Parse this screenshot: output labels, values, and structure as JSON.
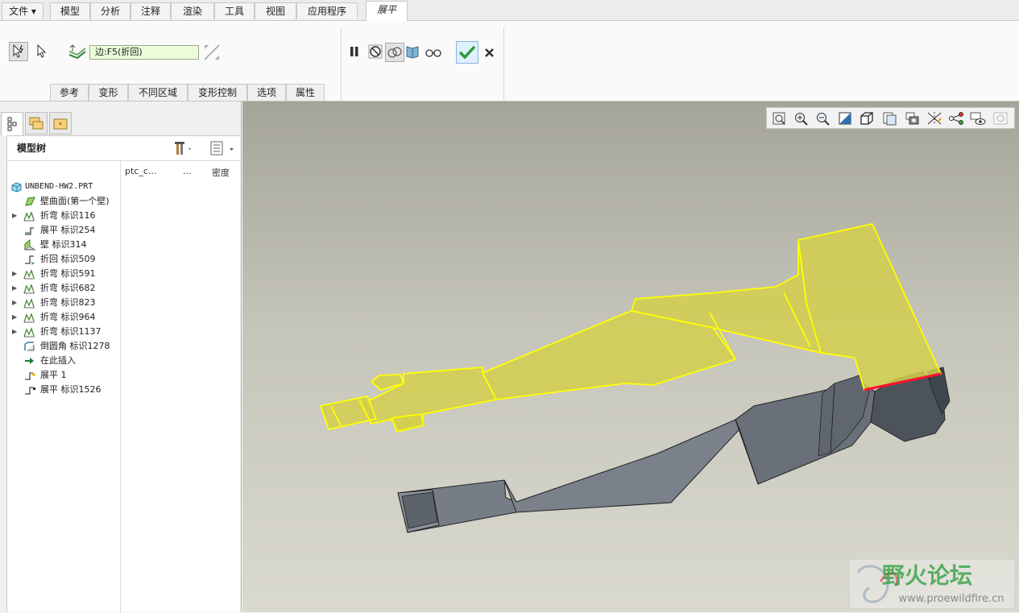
{
  "menu": {
    "items": [
      "文件",
      "模型",
      "分析",
      "注释",
      "渲染",
      "工具",
      "视图",
      "应用程序",
      "展平"
    ],
    "active": "展平"
  },
  "ribbon": {
    "edge_selector": "边:F5(折回)",
    "subtabs": [
      "参考",
      "变形",
      "不同区域",
      "变形控制",
      "选项",
      "属性"
    ]
  },
  "panel": {
    "title": "模型树",
    "columns": [
      "ptc_c...",
      "...",
      "密度"
    ],
    "tree": [
      {
        "label": "UNBEND-HW2.PRT",
        "icon": "part-icon",
        "expandable": false,
        "root": true
      },
      {
        "label": "壁曲面(第一个壁)",
        "icon": "wall-surface-icon",
        "expandable": false
      },
      {
        "label": "折弯 标识116",
        "icon": "bend-icon",
        "expandable": true
      },
      {
        "label": "展平 标识254",
        "icon": "unbend-icon",
        "expandable": false
      },
      {
        "label": "壁 标识314",
        "icon": "wall-icon",
        "expandable": false
      },
      {
        "label": "折回 标识509",
        "icon": "bendback-icon",
        "expandable": false
      },
      {
        "label": "折弯 标识591",
        "icon": "bend-icon",
        "expandable": true
      },
      {
        "label": "折弯 标识682",
        "icon": "bend-icon",
        "expandable": true
      },
      {
        "label": "折弯 标识823",
        "icon": "bend-icon",
        "expandable": true
      },
      {
        "label": "折弯 标识964",
        "icon": "bend-icon",
        "expandable": true
      },
      {
        "label": "折弯 标识1137",
        "icon": "bend-icon",
        "expandable": true
      },
      {
        "label": "倒圆角 标识1278",
        "icon": "round-icon",
        "expandable": false
      },
      {
        "label": "在此插入",
        "icon": "insert-here-icon",
        "expandable": false
      },
      {
        "label": "展平 1",
        "icon": "unbend-active-icon",
        "expandable": false
      },
      {
        "label": "展平 标识1526",
        "icon": "unbend-pending-icon",
        "expandable": false
      }
    ]
  },
  "watermark": {
    "title": "野火论坛",
    "url": "www.proewildfire.cn"
  },
  "colors": {
    "accent_green": "#2a9c3a",
    "flat_yellow": "#d2cf4e",
    "highlight_yellow": "#ffff00",
    "selected_edge": "#e8102a",
    "solid_gray": "#767d87"
  }
}
